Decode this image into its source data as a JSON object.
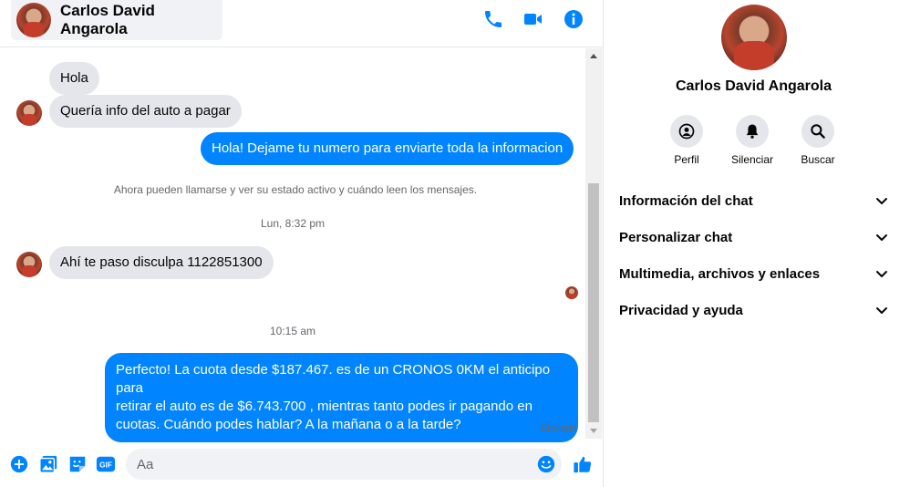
{
  "contact": {
    "name": "Carlos David Angarola"
  },
  "header_icons": [
    "phone-icon",
    "video-camera-icon",
    "info-icon"
  ],
  "colors": {
    "accent": "#0084ff",
    "incoming_bubble": "#e4e6eb",
    "system_text": "#65676b"
  },
  "messages": [
    {
      "from": "contact",
      "text": "Hola"
    },
    {
      "from": "contact",
      "text": "Quería info del auto a pagar"
    },
    {
      "from": "me",
      "text": "Hola! Dejame tu numero  para enviarte toda la informacion"
    },
    {
      "type": "system",
      "text": "Ahora pueden llamarse y ver su estado activo y cuándo leen los mensajes."
    },
    {
      "type": "timestamp",
      "text": "Lun, 8:32 pm"
    },
    {
      "from": "contact",
      "text": "Ahí te paso disculpa 1122851300"
    },
    {
      "type": "timestamp",
      "text": "10:15 am"
    },
    {
      "from": "me",
      "lines": [
        "Perfecto! La cuota desde $187.467. es de un CRONOS 0KM el anticipo para",
        "retirar el auto es de $6.743.700 , mientras tanto podes ir pagando en",
        "cuotas. Cuándo podes hablar? A la mañana o a la tarde?"
      ]
    }
  ],
  "delivery_status": "Enviado",
  "composer": {
    "placeholder": "Aa",
    "icons": [
      "plus-icon",
      "photo-icon",
      "sticker-icon",
      "gif-icon",
      "emoji-icon",
      "thumbs-up-icon"
    ],
    "gif_label": "GIF"
  },
  "info_panel": {
    "name": "Carlos David Angarola",
    "actions": [
      {
        "label": "Perfil",
        "icon": "profile-icon"
      },
      {
        "label": "Silenciar",
        "icon": "bell-icon"
      },
      {
        "label": "Buscar",
        "icon": "search-icon"
      }
    ],
    "sections": [
      {
        "label": "Información del chat"
      },
      {
        "label": "Personalizar chat"
      },
      {
        "label": "Multimedia, archivos y enlaces"
      },
      {
        "label": "Privacidad y ayuda"
      }
    ]
  }
}
